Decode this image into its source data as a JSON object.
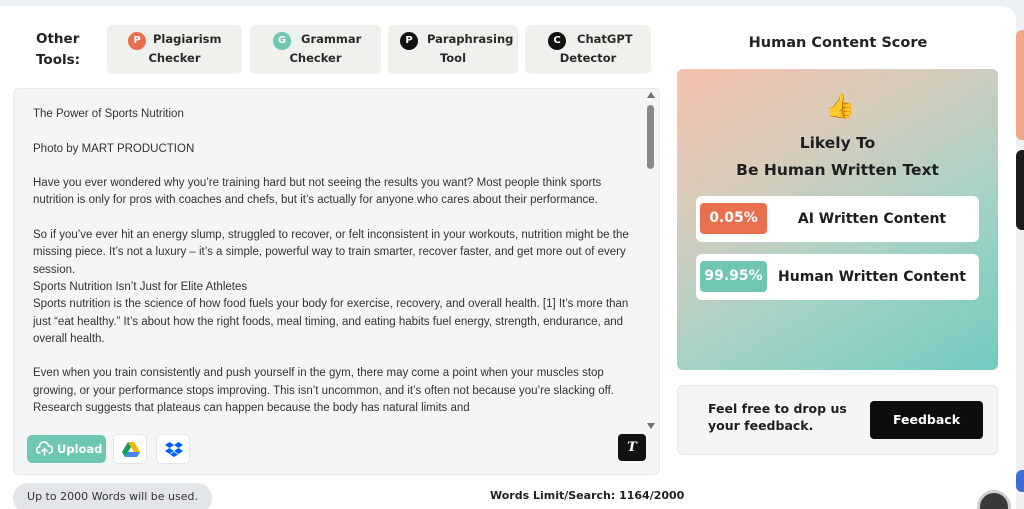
{
  "colors": {
    "accent_teal": "#6ec6b3",
    "ai_badge": "#e9704f",
    "human_badge": "#6ec6b3",
    "feedback_button": "#0d0d0d"
  },
  "other_tools": {
    "label_line1": "Other",
    "label_line2": "Tools:",
    "items": [
      {
        "icon_letter": "P",
        "icon_name": "plagiarism-icon",
        "icon_color": "#e9704f",
        "line1": "Plagiarism",
        "line2": "Checker"
      },
      {
        "icon_letter": "G",
        "icon_name": "grammar-icon",
        "icon_color": "#6ec6b3",
        "line1": "Grammar",
        "line2": "Checker"
      },
      {
        "icon_letter": "P",
        "icon_name": "paraphrasing-icon",
        "icon_color": "#111111",
        "line1": "Paraphrasing",
        "line2": "Tool"
      },
      {
        "icon_letter": "C",
        "icon_name": "chatgpt-icon",
        "icon_color": "#111111",
        "line1": "ChatGPT",
        "line2": "Detector"
      }
    ]
  },
  "editor": {
    "lines": [
      "The Power of Sports Nutrition",
      "Photo by MART  PRODUCTION",
      "Have you ever wondered why you’re training hard but not seeing the results you want? Most people think sports nutrition is only for pros with coaches and chefs, but it’s actually for anyone who cares about their performance.",
      "So if you’ve ever hit an energy slump, struggled to recover, or felt inconsistent in your workouts, nutrition might be the missing piece. It’s not a luxury – it’s a simple, powerful way to train smarter, recover faster, and get more out of every session.",
      "Sports Nutrition Isn’t Just for Elite Athletes",
      "Sports nutrition is the science of how food fuels your body for exercise, recovery, and overall health. [1] It’s more than just “eat healthy.” It’s about how the right foods, meal timing, and eating habits fuel energy, strength, endurance, and overall health.",
      "Even when you train consistently and push yourself in the gym, there may come a point when your muscles stop growing, or your performance stops improving. This isn’t uncommon, and it’s often not because you’re slacking off. Research suggests that plateaus can happen because the body has natural limits and"
    ],
    "upload_label": "Upload",
    "clear_icon_glyph": "T",
    "words_notice": "Up to 2000 Words will be used.",
    "words_limit": "Words Limit/Search: 1164/2000"
  },
  "score": {
    "title": "Human Content Score",
    "emoji": "👍",
    "verdict_line1": "Likely To",
    "verdict_line2": "Be Human Written Text",
    "ai_percent": "0.05%",
    "ai_label": "AI Written Content",
    "human_percent": "99.95%",
    "human_label": "Human Written Content"
  },
  "feedback": {
    "text_line1": "Feel free to drop us",
    "text_line2": "your feedback.",
    "button_label": "Feedback"
  }
}
